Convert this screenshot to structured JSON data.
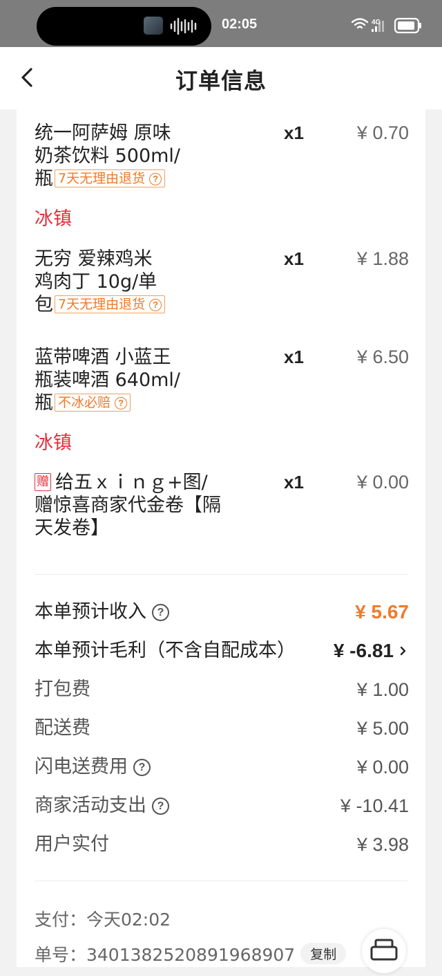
{
  "status_bar": {
    "time": "02:05",
    "network": "4G"
  },
  "header": {
    "title": "订单信息",
    "back_icon": "chevron-left-icon"
  },
  "items": [
    {
      "name_lines": [
        "统一阿萨姆 原味",
        "奶茶饮料 500ml/",
        "瓶"
      ],
      "tag": "7天无理由退货",
      "qty": "x1",
      "price": "¥ 0.70",
      "note": "冰镇"
    },
    {
      "name_lines": [
        "无穷 爱辣鸡米",
        "鸡肉丁 10g/单",
        "包"
      ],
      "tag": "7天无理由退货",
      "qty": "x1",
      "price": "¥ 1.88",
      "note": ""
    },
    {
      "name_lines": [
        "蓝带啤酒 小蓝王",
        "瓶装啤酒 640ml/",
        "瓶"
      ],
      "tag": "不冰必赔",
      "qty": "x1",
      "price": "¥ 6.50",
      "note": "冰镇"
    },
    {
      "gift_badge": "赠",
      "name_lines": [
        "给五ｘｉｎｇ+图/",
        "赠惊喜商家代金卷【隔",
        "天发卷】"
      ],
      "qty": "x1",
      "price": "¥ 0.00"
    }
  ],
  "fees": {
    "income_label": "本单预计收入",
    "income_value": "¥ 5.67",
    "profit_label": "本单预计毛利（不含自配成本）",
    "profit_value": "¥ -6.81",
    "packing_label": "打包费",
    "packing_value": "¥ 1.00",
    "delivery_label": "配送费",
    "delivery_value": "¥ 5.00",
    "flash_label": "闪电送费用",
    "flash_value": "¥ 0.00",
    "merchant_label": "商家活动支出",
    "merchant_value": "¥ -10.41",
    "user_paid_label": "用户实付",
    "user_paid_value": "¥ 3.98"
  },
  "payment": {
    "pay_time": "支付：今天02:02",
    "order_no": "单号：3401382520891968907",
    "copy_label": "复制"
  },
  "colors": {
    "accent_orange": "#f07a2b",
    "ice_red": "#e3303c"
  }
}
